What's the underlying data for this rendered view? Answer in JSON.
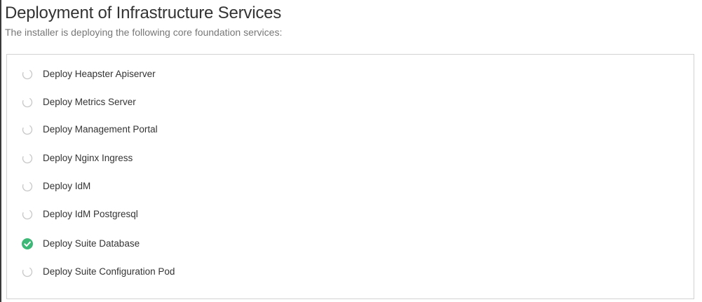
{
  "header": {
    "title": "Deployment of Infrastructure Services",
    "subtitle": "The installer is deploying the following core foundation services:"
  },
  "colors": {
    "pending_spinner": "#c8c8c8",
    "complete": "#3db876",
    "check": "#ffffff",
    "panel_border": "#d2d2d2",
    "text": "#333333",
    "subtitle": "#777777"
  },
  "tasks": [
    {
      "label": "Deploy Heapster Apiserver",
      "status": "pending",
      "icon": "loading-spinner-icon"
    },
    {
      "label": "Deploy Metrics Server",
      "status": "pending",
      "icon": "loading-spinner-icon"
    },
    {
      "label": "Deploy Management Portal",
      "status": "pending",
      "icon": "loading-spinner-icon"
    },
    {
      "label": "Deploy Nginx Ingress",
      "status": "pending",
      "icon": "loading-spinner-icon"
    },
    {
      "label": "Deploy IdM",
      "status": "pending",
      "icon": "loading-spinner-icon"
    },
    {
      "label": "Deploy IdM Postgresql",
      "status": "pending",
      "icon": "loading-spinner-icon"
    },
    {
      "label": "Deploy Suite Database",
      "status": "complete",
      "icon": "checkmark-circle-icon"
    },
    {
      "label": "Deploy Suite Configuration Pod",
      "status": "pending",
      "icon": "loading-spinner-icon"
    }
  ]
}
